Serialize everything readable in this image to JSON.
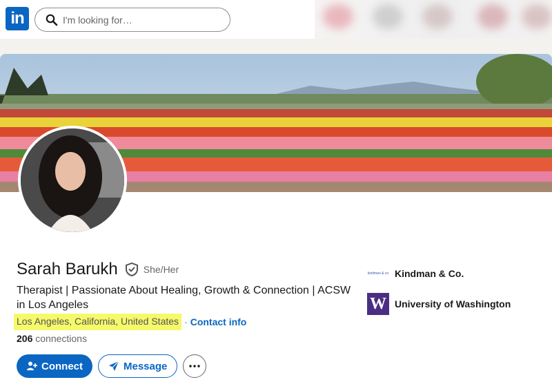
{
  "nav": {
    "logo_text": "in",
    "search_placeholder": "I'm looking for…",
    "brand_color": "#0a66c2"
  },
  "profile": {
    "name": "Sarah Barukh",
    "pronouns": "She/Her",
    "headline": "Therapist | Passionate About Healing, Growth & Connection | ACSW in Los Angeles",
    "location": "Los Angeles, California, United States",
    "location_separator": "·",
    "contact_info_label": "Contact info",
    "connections_count": "206",
    "connections_label": "connections",
    "highlight_color": "#f5f96a"
  },
  "actions": {
    "connect_label": "Connect",
    "message_label": "Message"
  },
  "organizations": [
    {
      "name": "Kindman & Co.",
      "logo_text": "kindman & co"
    },
    {
      "name": "University of Washington",
      "logo_text": "W"
    }
  ],
  "icons": {
    "search": "search-icon",
    "verified": "verified-shield-icon",
    "connect": "add-person-icon",
    "message": "send-icon",
    "more": "more-horizontal-icon"
  }
}
